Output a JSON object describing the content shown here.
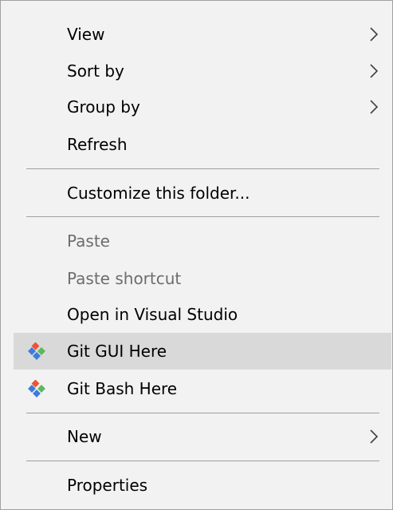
{
  "menu": {
    "view_label": "View",
    "sortby_label": "Sort by",
    "groupby_label": "Group by",
    "refresh_label": "Refresh",
    "customize_label": "Customize this folder...",
    "paste_label": "Paste",
    "paste_shortcut_label": "Paste shortcut",
    "open_vs_label": "Open in Visual Studio",
    "git_gui_label": "Git GUI Here",
    "git_bash_label": "Git Bash Here",
    "new_label": "New",
    "properties_label": "Properties"
  },
  "state": {
    "highlighted_item": "Git GUI Here",
    "disabled_items": [
      "Paste",
      "Paste shortcut"
    ],
    "submenu_items": [
      "View",
      "Sort by",
      "Group by",
      "New"
    ]
  },
  "icons": {
    "submenu": "chevron-right-icon",
    "git": "git-logo-icon"
  },
  "colors": {
    "menu_background": "#f2f2f2",
    "highlight": "#d9d9d9",
    "disabled_text": "#6d6d6d",
    "separator": "#a0a0a0",
    "git_red": "#f05133",
    "git_green": "#5cb85c",
    "git_blue": "#3b7dd8"
  }
}
